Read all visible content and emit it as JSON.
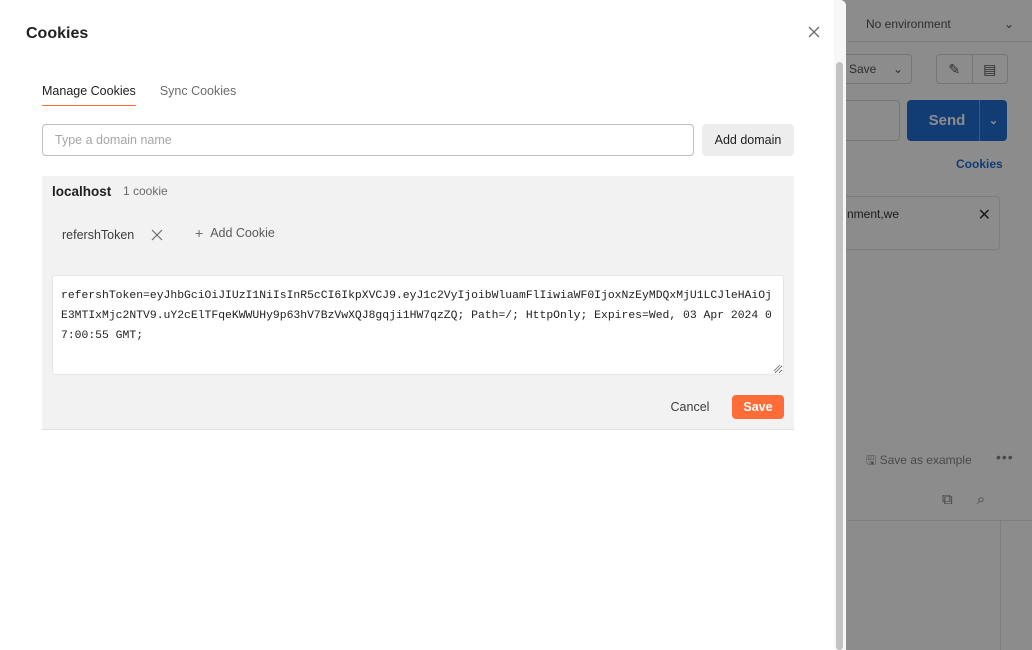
{
  "background": {
    "environment_label": "No environment",
    "save_label": "Save",
    "send_label": "Send",
    "cookies_link": "Cookies",
    "notice_text": "nment,we",
    "save_as_example": "Save as example"
  },
  "modal": {
    "title": "Cookies",
    "tabs": [
      {
        "label": "Manage Cookies",
        "active": true
      },
      {
        "label": "Sync Cookies",
        "active": false
      }
    ],
    "domain_input": {
      "value": "",
      "placeholder": "Type a domain name"
    },
    "add_domain_label": "Add domain",
    "domains": [
      {
        "name": "localhost",
        "count_label": "1 cookie",
        "cookies": [
          {
            "name": "refershToken"
          }
        ],
        "add_cookie_label": "Add Cookie",
        "editor_text": "refershToken=eyJhbGciOiJIUzI1NiIsInR5cCI6IkpXVCJ9.eyJ1c2VyIjoibWluamFlIiwiaWF0IjoxNzEyMDQxMjU1LCJleHAiOjE3MTIxMjc2NTV9.uY2cElTFqeKWWUHy9p63hV7BzVwXQJ8gqji1HW7qzZQ; Path=/; HttpOnly; Expires=Wed, 03 Apr 2024 07:00:55 GMT;",
        "cancel_label": "Cancel",
        "save_label": "Save"
      }
    ]
  },
  "colors": {
    "accent": "#ff6c37",
    "primary_blue": "#1f6ed4"
  }
}
